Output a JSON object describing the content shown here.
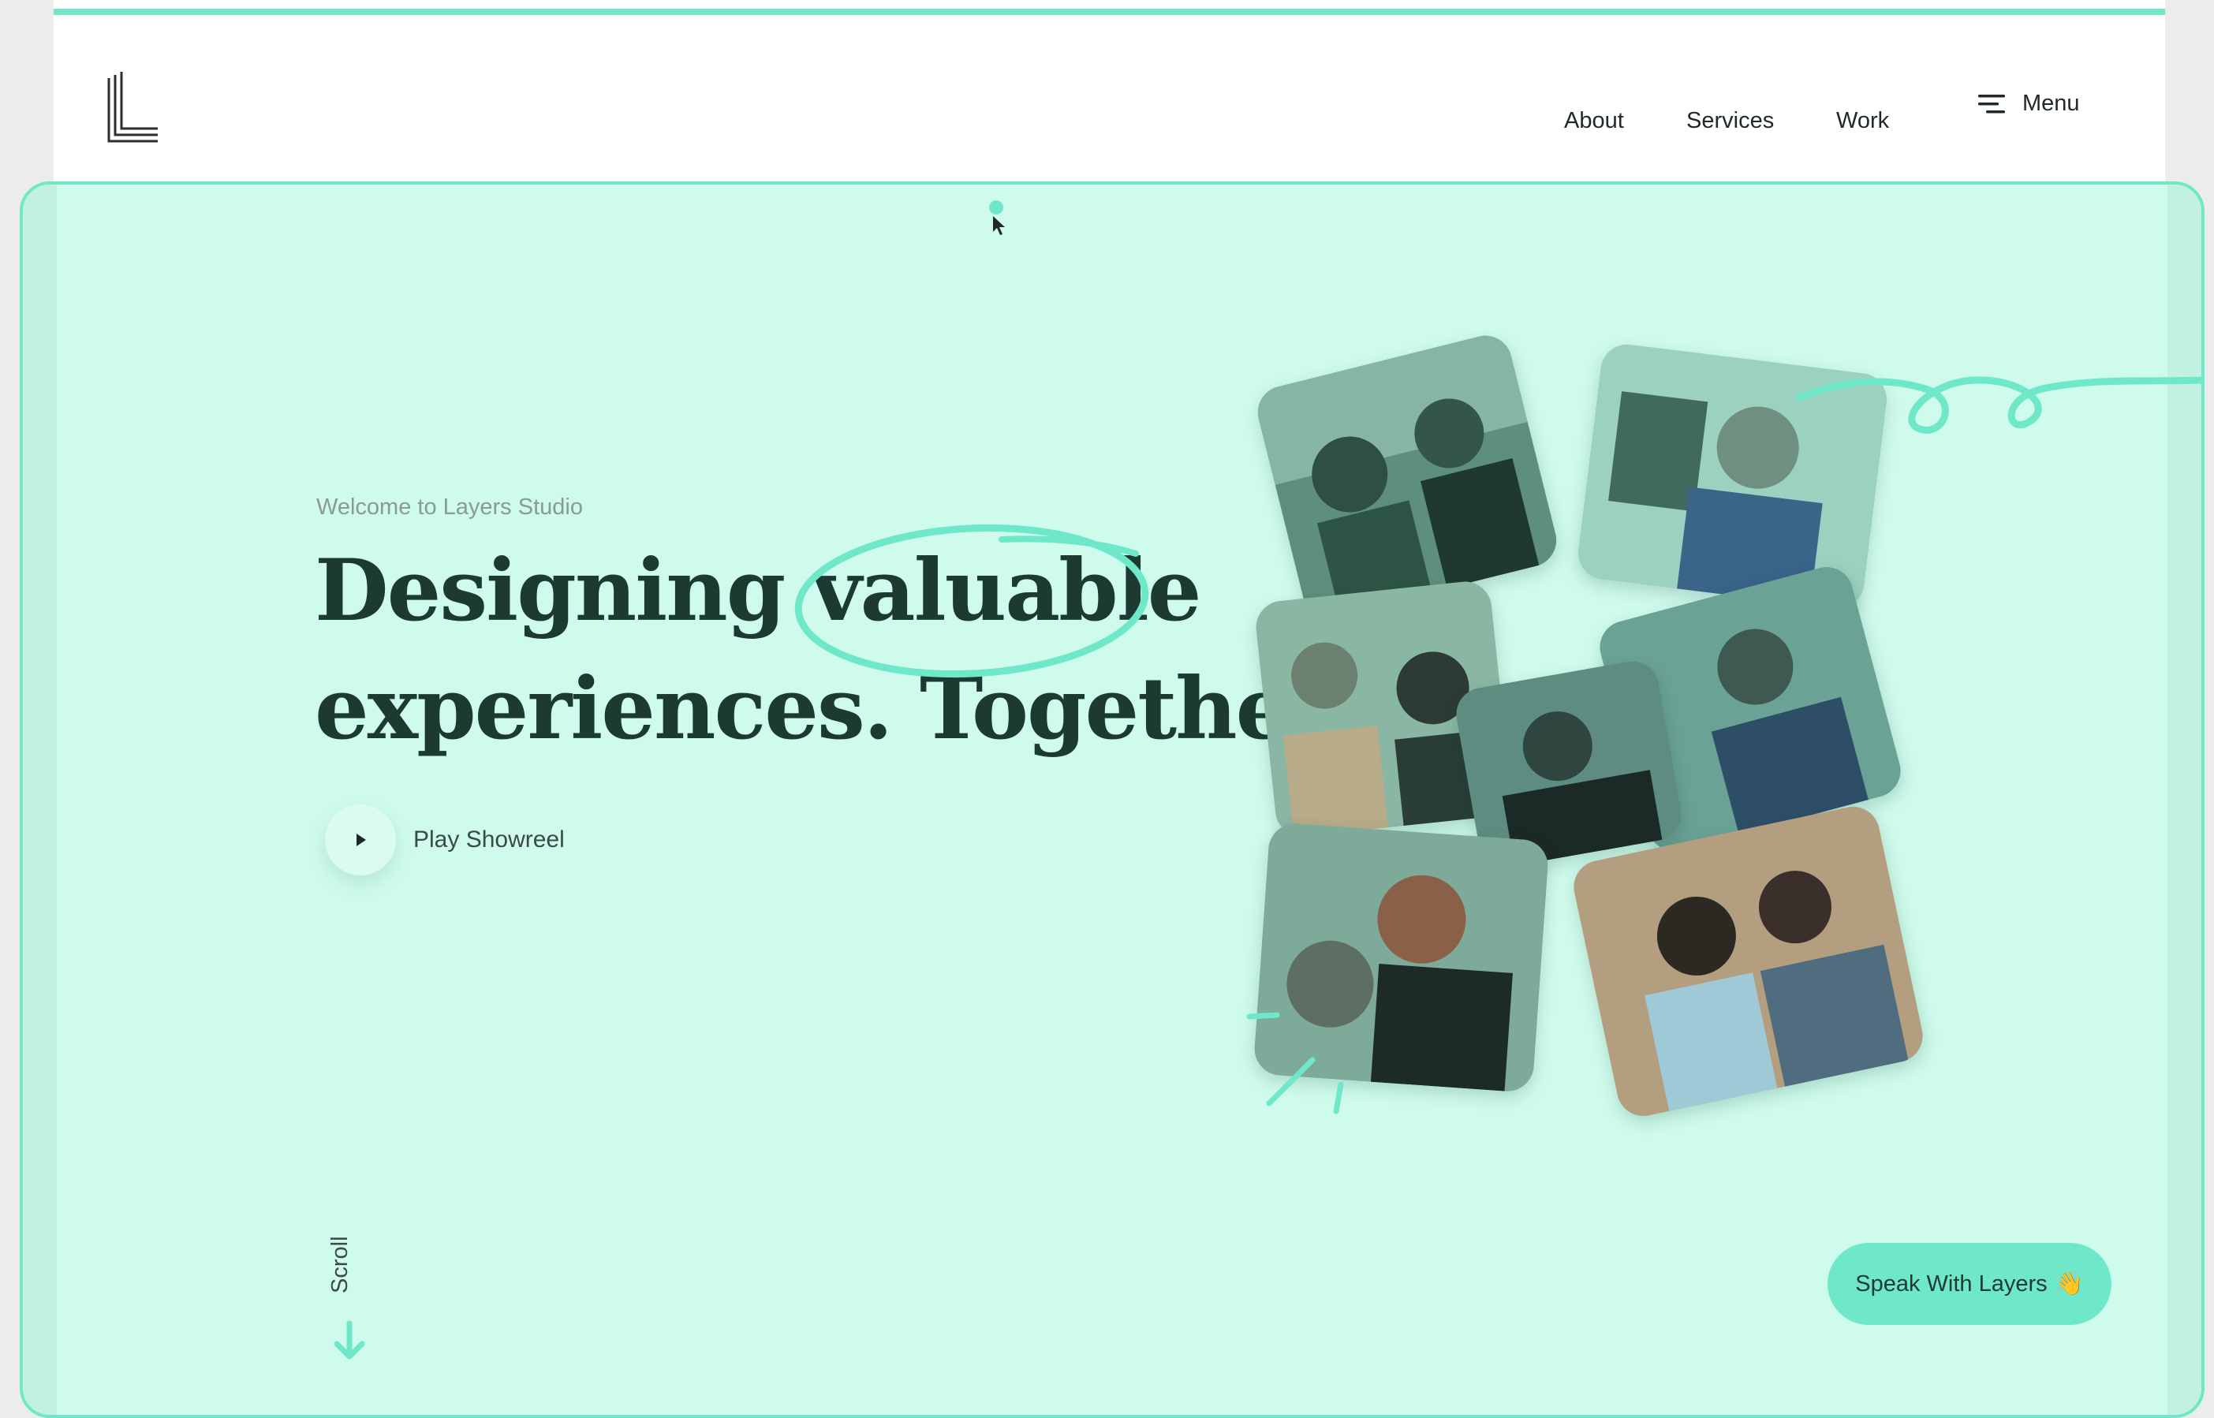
{
  "nav": {
    "about": "About",
    "services": "Services",
    "work": "Work",
    "menu": "Menu"
  },
  "hero": {
    "welcome": "Welcome to Layers Studio",
    "headline_word1": "Designing",
    "headline_word2": "valuable",
    "headline_line2": "experiences. Together.",
    "play_label": "Play Showreel",
    "scroll_label": "Scroll",
    "cta_label": "Speak With Layers",
    "cta_emoji": "👋"
  },
  "colors": {
    "accent": "#6ee8c9",
    "hero_bg": "#cffbec",
    "headline": "#1c3a31"
  },
  "icons": [
    "logo-mark",
    "menu-icon",
    "play-icon",
    "scroll-arrow-icon",
    "wave-icon",
    "cursor-icon"
  ]
}
